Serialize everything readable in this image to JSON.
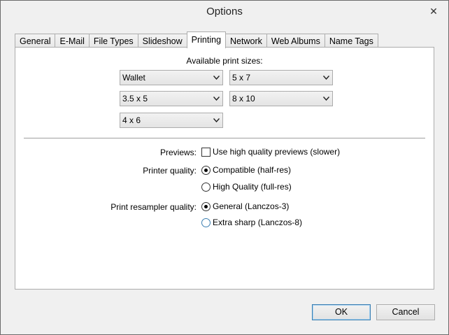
{
  "window": {
    "title": "Options"
  },
  "tabs": [
    {
      "label": "General"
    },
    {
      "label": "E-Mail"
    },
    {
      "label": "File Types"
    },
    {
      "label": "Slideshow"
    },
    {
      "label": "Printing",
      "active": true
    },
    {
      "label": "Network"
    },
    {
      "label": "Web Albums"
    },
    {
      "label": "Name Tags"
    }
  ],
  "printing": {
    "available_label": "Available print sizes:",
    "sizes": [
      "Wallet",
      "5 x 7",
      "3.5 x 5",
      "8 x 10",
      "4 x 6"
    ],
    "previews_label": "Previews:",
    "previews_option": "Use high quality previews (slower)",
    "previews_checked": false,
    "quality_label": "Printer quality:",
    "quality_options": [
      "Compatible (half-res)",
      "High Quality (full-res)"
    ],
    "quality_selected": "Compatible (half-res)",
    "resampler_label": "Print resampler quality:",
    "resampler_options": [
      "General (Lanczos-3)",
      "Extra sharp (Lanczos-8)"
    ],
    "resampler_selected": "General (Lanczos-3)"
  },
  "buttons": {
    "ok": "OK",
    "cancel": "Cancel"
  },
  "icons": {
    "close": "close-icon",
    "dropdown": "chevron-down-icon"
  }
}
